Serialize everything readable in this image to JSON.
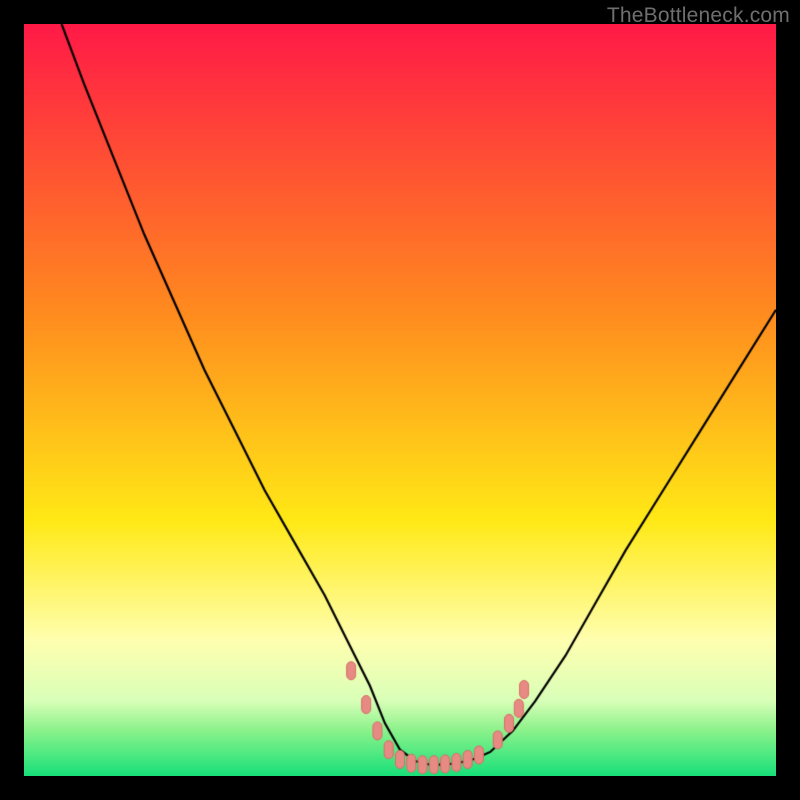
{
  "watermark": "TheBottleneck.com",
  "colors": {
    "frame_bg": "#000000",
    "gradient_top": "#ff1a47",
    "gradient_mid_orange": "#ff8a1f",
    "gradient_yellow": "#ffe916",
    "gradient_pale_yellow": "#ffffb0",
    "gradient_green_light": "#8af28a",
    "gradient_green": "#18e07a",
    "curve": "#000000",
    "marker_fill": "#e78a84",
    "marker_stroke": "#d86e66"
  },
  "chart_data": {
    "type": "line",
    "title": "",
    "xlabel": "",
    "ylabel": "",
    "xlim": [
      0,
      100
    ],
    "ylim": [
      0,
      100
    ],
    "series": [
      {
        "name": "bottleneck-curve",
        "x": [
          5,
          8,
          12,
          16,
          20,
          24,
          28,
          32,
          36,
          40,
          43,
          46,
          48,
          50,
          52,
          54,
          56,
          58,
          60,
          62,
          65,
          68,
          72,
          76,
          80,
          85,
          90,
          95,
          100
        ],
        "y": [
          100,
          92,
          82,
          72,
          63,
          54,
          46,
          38,
          31,
          24,
          18,
          12,
          7,
          3.5,
          2,
          1.5,
          1.5,
          1.8,
          2.3,
          3.2,
          6,
          10,
          16,
          23,
          30,
          38,
          46,
          54,
          62
        ]
      }
    ],
    "markers": [
      {
        "x": 43.5,
        "y": 14,
        "r": 1.0
      },
      {
        "x": 45.5,
        "y": 9.5,
        "r": 1.0
      },
      {
        "x": 47.0,
        "y": 6.0,
        "r": 1.2
      },
      {
        "x": 48.5,
        "y": 3.5,
        "r": 1.2
      },
      {
        "x": 50.0,
        "y": 2.2,
        "r": 1.2
      },
      {
        "x": 51.5,
        "y": 1.7,
        "r": 1.2
      },
      {
        "x": 53.0,
        "y": 1.5,
        "r": 1.2
      },
      {
        "x": 54.5,
        "y": 1.5,
        "r": 1.2
      },
      {
        "x": 56.0,
        "y": 1.6,
        "r": 1.2
      },
      {
        "x": 57.5,
        "y": 1.8,
        "r": 1.2
      },
      {
        "x": 59.0,
        "y": 2.2,
        "r": 1.2
      },
      {
        "x": 60.5,
        "y": 2.8,
        "r": 1.2
      },
      {
        "x": 63.0,
        "y": 4.8,
        "r": 1.0
      },
      {
        "x": 64.5,
        "y": 7.0,
        "r": 1.0
      },
      {
        "x": 65.8,
        "y": 9.0,
        "r": 1.0
      },
      {
        "x": 66.5,
        "y": 11.5,
        "r": 1.0
      }
    ]
  }
}
